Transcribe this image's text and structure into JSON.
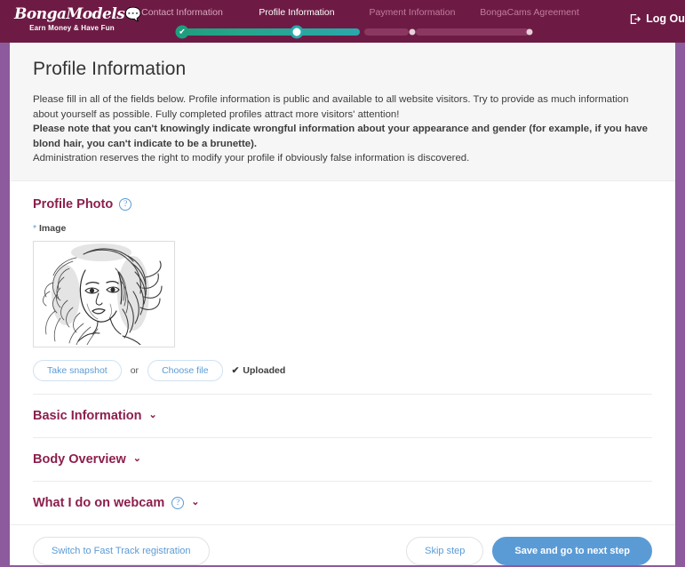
{
  "header": {
    "logo_text": "BongaModels",
    "logo_tagline": "Earn Money & Have Fun",
    "logout_label": "Log Out",
    "logout_icon": "logout-icon",
    "steps": [
      {
        "label": "Contact Information",
        "state": "done"
      },
      {
        "label": "Profile Information",
        "state": "current"
      },
      {
        "label": "Payment Information",
        "state": "todo"
      },
      {
        "label": "BongaCams Agreement",
        "state": "todo"
      }
    ],
    "check_glyph": "✔"
  },
  "intro": {
    "title": "Profile Information",
    "paragraph1": "Please fill in all of the fields below. Profile information is public and available to all website visitors. Try to provide as much information about yourself as possible. Fully completed profiles attract more visitors' attention!",
    "paragraph2": "Please note that you can't knowingly indicate wrongful information about your appearance and gender (for example, if you have blond hair, you can't indicate to be a brunette).",
    "paragraph3": "Administration reserves the right to modify your profile if obviously false information is discovered."
  },
  "photo_section": {
    "title": "Profile Photo",
    "help_glyph": "?",
    "image_label_required": "*",
    "image_label": "Image",
    "take_snapshot_label": "Take snapshot",
    "or_label": "or",
    "choose_file_label": "Choose file",
    "uploaded_label": "Uploaded",
    "uploaded_check": "✔",
    "photo_alt": "profile-photo-sketch-portrait"
  },
  "accordions": [
    {
      "title": "Basic Information",
      "has_help": false,
      "chevron": "⌄"
    },
    {
      "title": "Body Overview",
      "has_help": false,
      "chevron": "⌄"
    },
    {
      "title": "What I do on webcam",
      "has_help": true,
      "help_glyph": "?",
      "chevron": "⌄"
    }
  ],
  "footer": {
    "fast_track_label": "Switch to Fast Track registration",
    "skip_label": "Skip step",
    "save_label": "Save and go to next step"
  },
  "colors": {
    "header_bg": "#6d1b45",
    "page_border": "#8d5a9d",
    "accent_maroon": "#8c1f4d",
    "accent_blue": "#5b9bd5",
    "progress_done": "#1f9e7e",
    "progress_current": "#2aa8ab",
    "progress_track": "#8b3861",
    "intro_bg": "#f6f6f6"
  }
}
